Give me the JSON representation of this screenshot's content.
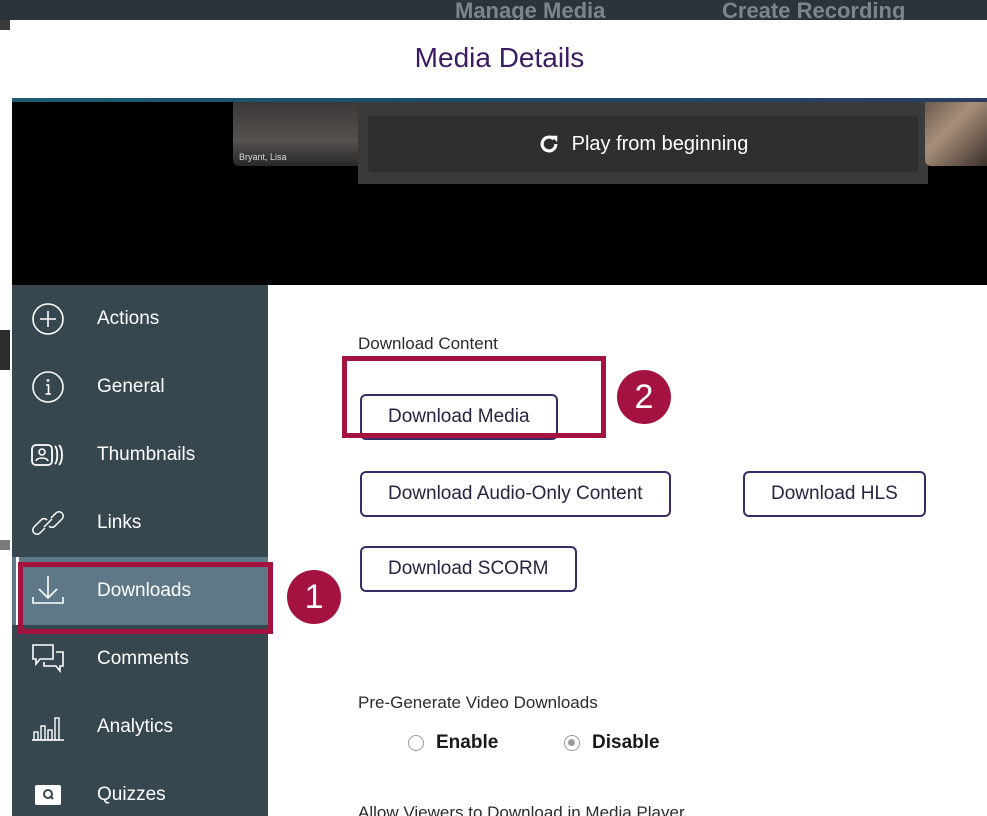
{
  "background": {
    "top_left_text": "Manage Media",
    "top_right_text": "Create Recording"
  },
  "modal": {
    "title": "Media Details"
  },
  "video": {
    "thumbnail_name": "Bryant, Lisa",
    "play_button_label": "Play from beginning",
    "play_icon": "replay-icon"
  },
  "sidebar": {
    "items": [
      {
        "label": "Actions",
        "icon": "plus-circle-icon"
      },
      {
        "label": "General",
        "icon": "info-icon"
      },
      {
        "label": "Thumbnails",
        "icon": "thumbnails-icon"
      },
      {
        "label": "Links",
        "icon": "link-icon"
      },
      {
        "label": "Downloads",
        "icon": "download-icon",
        "active": true
      },
      {
        "label": "Comments",
        "icon": "comments-icon"
      },
      {
        "label": "Analytics",
        "icon": "analytics-icon"
      },
      {
        "label": "Quizzes",
        "icon": "quiz-icon"
      }
    ]
  },
  "content": {
    "download_section_title": "Download Content",
    "buttons": {
      "download_media": "Download Media",
      "download_audio": "Download Audio-Only Content",
      "download_hls": "Download HLS",
      "download_scorm": "Download SCORM"
    },
    "pregenerate": {
      "title": "Pre-Generate Video Downloads",
      "options": [
        {
          "label": "Enable",
          "checked": false
        },
        {
          "label": "Disable",
          "checked": true
        }
      ]
    },
    "allow_viewers_title": "Allow Viewers to Download in Media Player"
  },
  "annotations": {
    "step1": "1",
    "step2": "2",
    "color": "#a4123f"
  },
  "colors": {
    "sidebar_bg": "#37474f",
    "sidebar_active": "#5f7887",
    "title_color": "#3b1b62",
    "button_border": "#3b2a66"
  }
}
